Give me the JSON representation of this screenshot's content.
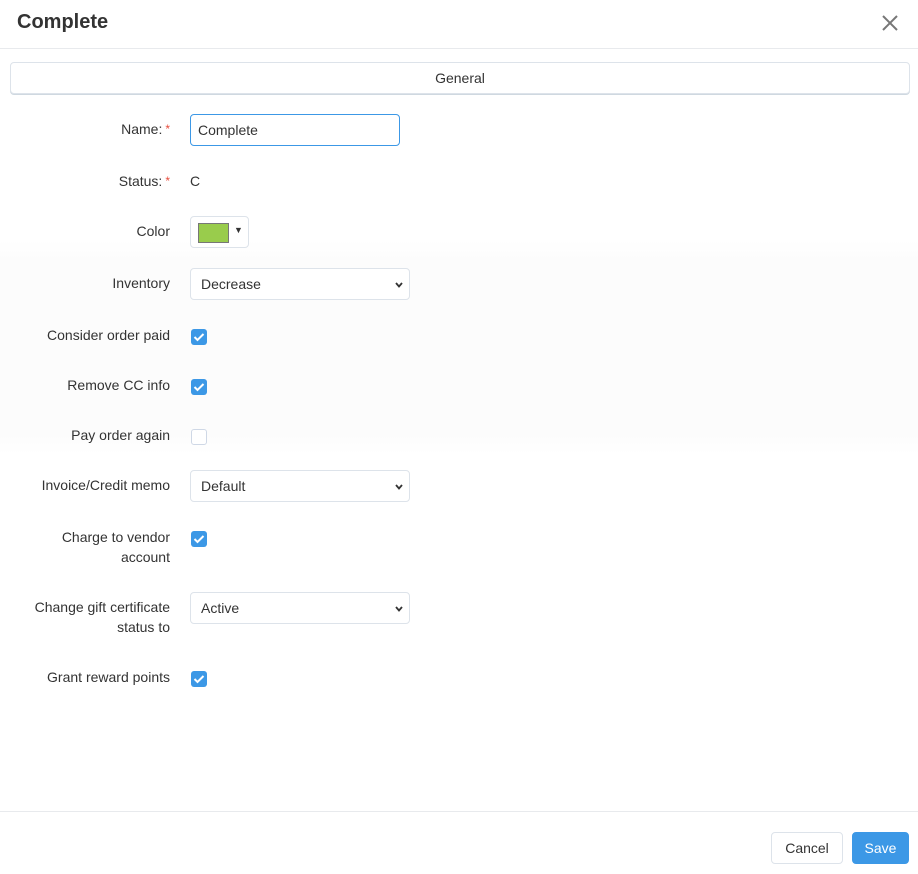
{
  "dialog": {
    "title": "Complete",
    "close_icon": "close-icon"
  },
  "tabs": [
    {
      "label": "General",
      "active": true
    }
  ],
  "form": {
    "name": {
      "label": "Name:",
      "required": "*",
      "value": "Complete"
    },
    "status": {
      "label": "Status:",
      "required": "*",
      "value": "C"
    },
    "color": {
      "label": "Color",
      "value": "#99cc4c",
      "caret": "▼"
    },
    "inventory": {
      "label": "Inventory",
      "value": "Decrease"
    },
    "consider_order_paid": {
      "label": "Consider order paid",
      "checked": true
    },
    "remove_cc_info": {
      "label": "Remove CC info",
      "checked": true
    },
    "pay_order_again": {
      "label": "Pay order again",
      "checked": false
    },
    "invoice_credit_memo": {
      "label": "Invoice/Credit memo",
      "value": "Default"
    },
    "charge_to_vendor": {
      "label_line1": "Charge to vendor",
      "label_line2": "account",
      "checked": true
    },
    "gift_certificate_status": {
      "label_line1": "Change gift certificate",
      "label_line2": "status to",
      "value": "Active"
    },
    "grant_reward_points": {
      "label": "Grant reward points",
      "checked": true
    }
  },
  "footer": {
    "cancel_label": "Cancel",
    "save_label": "Save"
  },
  "colors": {
    "accent": "#3c98e6",
    "required": "#e74c3c"
  }
}
